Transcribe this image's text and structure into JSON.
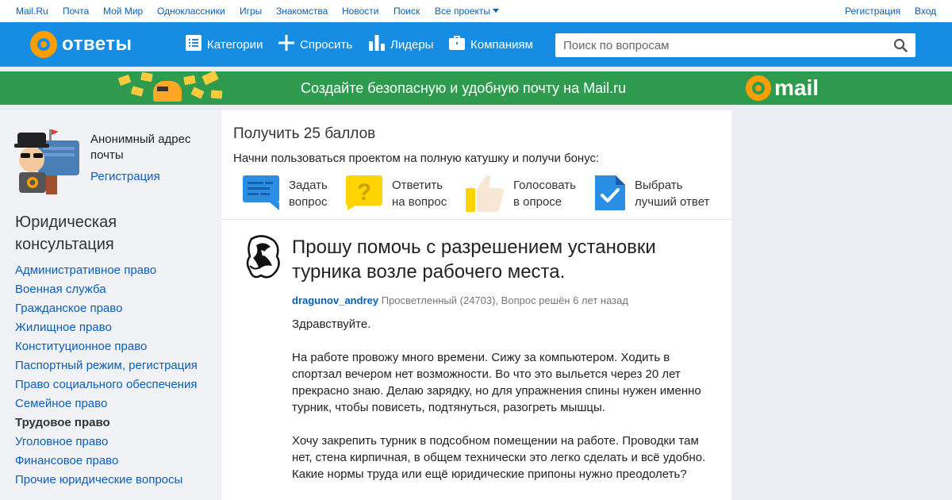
{
  "topbar": {
    "links": [
      "Mail.Ru",
      "Почта",
      "Мой Мир",
      "Одноклассники",
      "Игры",
      "Знакомства",
      "Новости",
      "Поиск",
      "Все проекты"
    ],
    "register": "Регистрация",
    "login": "Вход"
  },
  "header": {
    "logo_text": "ответы",
    "nav": {
      "categories": "Категории",
      "ask": "Спросить",
      "leaders": "Лидеры",
      "companies": "Компаниям"
    },
    "search_placeholder": "Поиск по вопросам"
  },
  "banner": {
    "text": "Создайте безопасную и удобную почту на Mail.ru",
    "brand": "mail"
  },
  "sidebar": {
    "anon_text": "Анонимный адрес почты",
    "anon_register": "Регистрация",
    "section_title": "Юридическая консультация",
    "categories": [
      "Административное право",
      "Военная служба",
      "Гражданское право",
      "Жилищное право",
      "Конституционное право",
      "Паспортный режим, регистрация",
      "Право социального обеспечения",
      "Семейное право",
      "Трудовое право",
      "Уголовное право",
      "Финансовое право",
      "Прочие юридические вопросы"
    ],
    "active_category": "Трудовое право"
  },
  "bonus": {
    "title": "Получить 25 баллов",
    "subtitle": "Начни пользоваться проектом на полную катушку и получи бонус:",
    "items": [
      {
        "line1": "Задать",
        "line2": "вопрос",
        "icon": "speech-bubble-icon"
      },
      {
        "line1": "Ответить",
        "line2": "на вопрос",
        "icon": "question-bubble-icon"
      },
      {
        "line1": "Голосовать",
        "line2": "в опросе",
        "icon": "thumbs-up-icon"
      },
      {
        "line1": "Выбрать",
        "line2": "лучший ответ",
        "icon": "checkmark-icon"
      }
    ]
  },
  "question": {
    "title": "Прошу помочь с разрешением установки турника возле рабочего места.",
    "author": "dragunov_andrey",
    "meta": "Просветленный (24703), Вопрос решён 6 лет назад",
    "paragraphs": [
      "Здравствуйте.",
      "На работе провожу много времени. Сижу за компьютером. Ходить в спортзал вечером нет возможности. Во что это выльется через 20 лет прекрасно знаю. Делаю зарядку, но для упражнения спины нужен именно турник, чтобы повисеть, подтянуться, разогреть мышцы.",
      "Хочу закрепить турник в подсобном помещении на работе. Проводки там нет, стена кирпичная, в общем технически это легко сделать и всё удобно. Какие нормы труда или ещё юридические припоны нужно преодолеть?"
    ]
  },
  "colors": {
    "header_blue": "#168de2",
    "banner_green": "#2f9b4e",
    "link_blue": "#0b5eb7",
    "accent_orange": "#ff9e00"
  }
}
